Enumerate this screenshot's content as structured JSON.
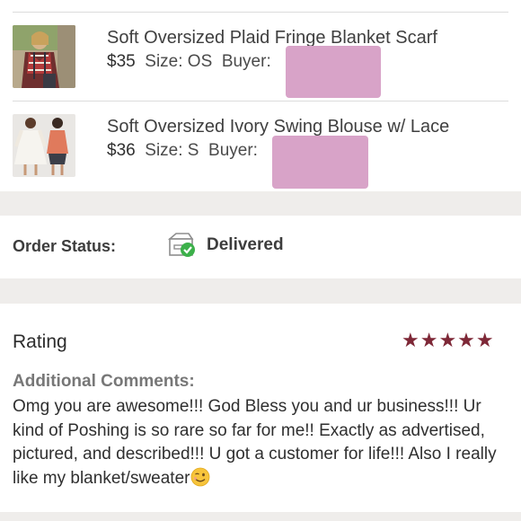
{
  "items": [
    {
      "title": "Soft Oversized Plaid Fringe Blanket Scarf",
      "price": "$35",
      "size_label": "Size: OS",
      "buyer_label": "Buyer:"
    },
    {
      "title": "Soft Oversized Ivory Swing Blouse w/ Lace",
      "price": "$36",
      "size_label": "Size: S",
      "buyer_label": "Buyer:"
    }
  ],
  "order": {
    "label": "Order Status:",
    "status": "Delivered",
    "status_icon": "delivered-box-check-icon",
    "status_color": "#3cb04a"
  },
  "rating": {
    "title": "Rating",
    "stars_display": "★★★★★",
    "star_count": 5,
    "star_color": "#7e2837",
    "comments_label": "Additional Comments:",
    "comments": "Omg you are awesome!!! God Bless you and ur business!!! Ur kind of Poshing is so rare so far for me!! Exactly as advertised, pictured, and described!!! U got a customer for life!!! Also I really like my blanket/sweater",
    "emoji": "winking-face-emoji"
  },
  "colors": {
    "background": "#efedeb",
    "redaction": "#d8a3c8"
  }
}
